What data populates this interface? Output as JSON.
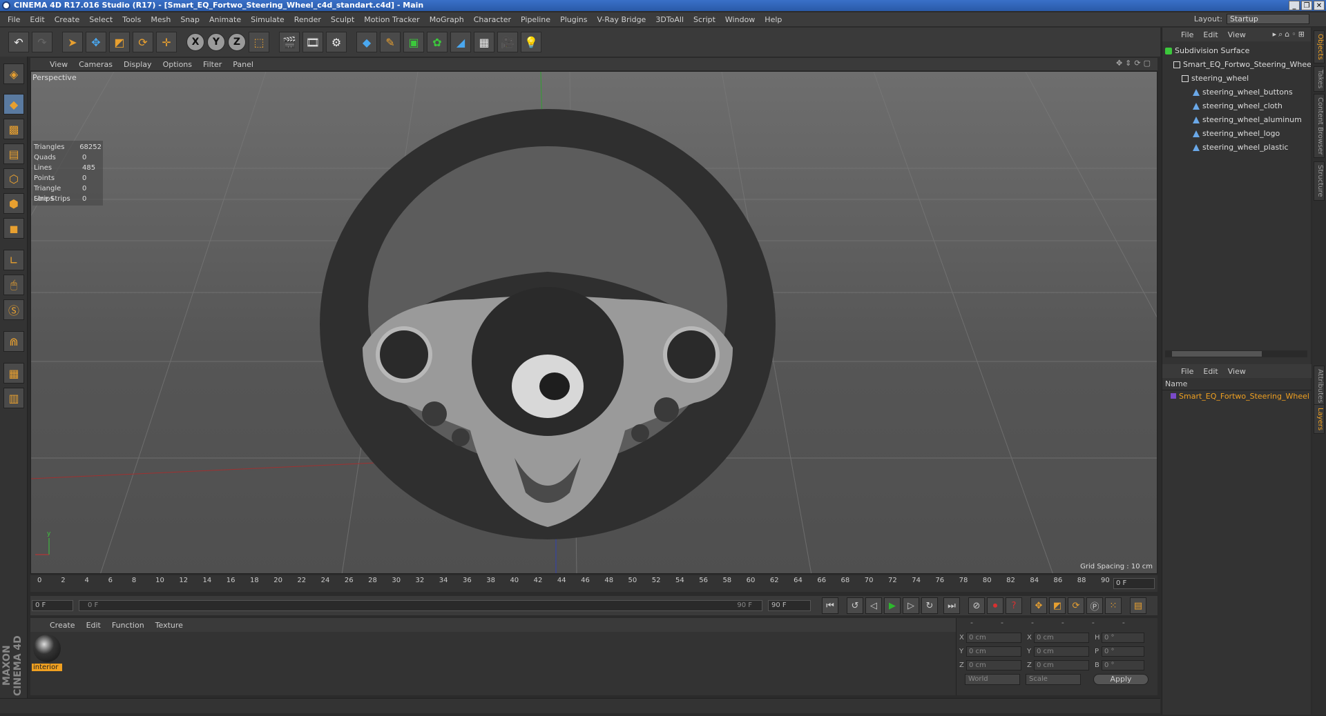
{
  "window": {
    "title": "CINEMA 4D R17.016 Studio (R17) - [Smart_EQ_Fortwo_Steering_Wheel_c4d_standart.c4d] - Main"
  },
  "menubar": {
    "items": [
      "File",
      "Edit",
      "Create",
      "Select",
      "Tools",
      "Mesh",
      "Snap",
      "Animate",
      "Simulate",
      "Render",
      "Sculpt",
      "Motion Tracker",
      "MoGraph",
      "Character",
      "Pipeline",
      "Plugins",
      "V-Ray Bridge",
      "3DToAll",
      "Script",
      "Window",
      "Help"
    ],
    "layout_label": "Layout:",
    "layout_value": "Startup"
  },
  "viewport": {
    "menu": [
      "View",
      "Cameras",
      "Display",
      "Options",
      "Filter",
      "Panel"
    ],
    "camera_label": "Perspective",
    "stats": [
      {
        "label": "Triangles",
        "value": "68252"
      },
      {
        "label": "Quads",
        "value": "0"
      },
      {
        "label": "Lines",
        "value": "485"
      },
      {
        "label": "Points",
        "value": "0"
      },
      {
        "label": "Triangle Strips",
        "value": "0"
      },
      {
        "label": "Line Strips",
        "value": "0"
      }
    ],
    "grid_spacing": "Grid Spacing : 10 cm"
  },
  "timeline": {
    "ticks": [
      "0",
      "2",
      "4",
      "6",
      "8",
      "10",
      "12",
      "14",
      "16",
      "18",
      "20",
      "22",
      "24",
      "26",
      "28",
      "30",
      "32",
      "34",
      "36",
      "38",
      "40",
      "42",
      "44",
      "46",
      "48",
      "50",
      "52",
      "54",
      "56",
      "58",
      "60",
      "62",
      "64",
      "66",
      "68",
      "70",
      "72",
      "74",
      "76",
      "78",
      "80",
      "82",
      "84",
      "86",
      "88",
      "90"
    ],
    "current_frame": "0 F",
    "start_field": "0 F",
    "range_start": "0 F",
    "range_end": "90 F",
    "end_field": "90 F"
  },
  "material_manager": {
    "menu": [
      "Create",
      "Edit",
      "Function",
      "Texture"
    ],
    "materials": [
      {
        "name": "interior"
      }
    ]
  },
  "coordinates": {
    "header": [
      "--",
      "--",
      "--"
    ],
    "rows": [
      {
        "a": "X",
        "av": "0 cm",
        "b": "X",
        "bv": "0 cm",
        "c": "H",
        "cv": "0 °"
      },
      {
        "a": "Y",
        "av": "0 cm",
        "b": "Y",
        "bv": "0 cm",
        "c": "P",
        "cv": "0 °"
      },
      {
        "a": "Z",
        "av": "0 cm",
        "b": "Z",
        "bv": "0 cm",
        "c": "B",
        "cv": "0 °"
      }
    ],
    "world": "World",
    "scale": "Scale",
    "apply": "Apply"
  },
  "object_manager": {
    "menu": [
      "File",
      "Edit",
      "View"
    ],
    "tree": [
      {
        "name": "Subdivision Surface",
        "icon": "subdivision-icon",
        "depth": 0
      },
      {
        "name": "Smart_EQ_Fortwo_Steering_Whee",
        "icon": "null-icon",
        "depth": 1
      },
      {
        "name": "steering_wheel",
        "icon": "null-icon",
        "depth": 2
      },
      {
        "name": "steering_wheel_buttons",
        "icon": "polygon-icon",
        "depth": 3
      },
      {
        "name": "steering_wheel_cloth",
        "icon": "polygon-icon",
        "depth": 3
      },
      {
        "name": "steering_wheel_aluminum",
        "icon": "polygon-icon",
        "depth": 3
      },
      {
        "name": "steering_wheel_logo",
        "icon": "polygon-icon",
        "depth": 3
      },
      {
        "name": "steering_wheel_plastic",
        "icon": "polygon-icon",
        "depth": 3
      }
    ]
  },
  "layer_manager": {
    "menu": [
      "File",
      "Edit",
      "View"
    ],
    "column": "Name",
    "items": [
      "Smart_EQ_Fortwo_Steering_Wheel"
    ]
  },
  "side_tabs": [
    "Objects",
    "Takes",
    "Content Browser",
    "Structure",
    "Attributes",
    "Layers"
  ],
  "brand": "MAXON CINEMA 4D"
}
